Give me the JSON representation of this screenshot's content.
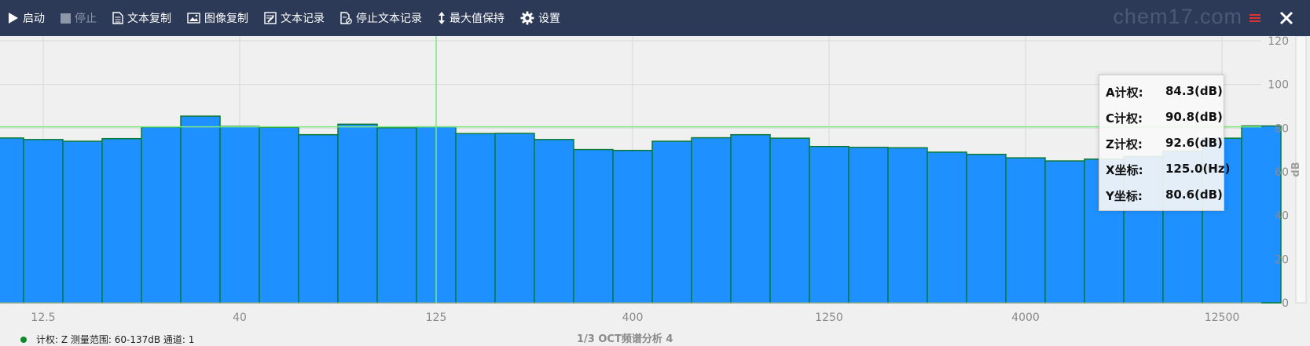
{
  "toolbar": {
    "start_label": "启动",
    "stop_label": "停止",
    "copy_text_label": "文本复制",
    "copy_image_label": "图像复制",
    "text_record_label": "文本记录",
    "stop_text_record_label": "停止文本记录",
    "max_hold_label": "最大值保持",
    "settings_label": "设置"
  },
  "watermark": "chem17.com",
  "readout": {
    "rows": [
      {
        "label": "A计权:",
        "value": "84.3(dB)"
      },
      {
        "label": "C计权:",
        "value": "90.8(dB)"
      },
      {
        "label": "Z计权:",
        "value": "92.6(dB)"
      },
      {
        "label": "X坐标:",
        "value": "125.0(Hz)"
      },
      {
        "label": "Y坐标:",
        "value": "80.6(dB)"
      }
    ]
  },
  "status": {
    "text": "计权: Z  测量范围: 60-137dB  通道: 1"
  },
  "chart_data": {
    "type": "bar",
    "title": "1/3 OCT频谱分析 4",
    "ylabel": "dB",
    "xlabel": "",
    "ylim": [
      0,
      120
    ],
    "yticks": [
      0,
      20,
      40,
      60,
      80,
      100,
      120
    ],
    "xtick_labels": [
      {
        "label": "12.5",
        "band": 1
      },
      {
        "label": "40",
        "band": 6
      },
      {
        "label": "125",
        "band": 11
      },
      {
        "label": "400",
        "band": 16
      },
      {
        "label": "1250",
        "band": 21
      },
      {
        "label": "4000",
        "band": 26
      },
      {
        "label": "12500",
        "band": 31
      }
    ],
    "values": [
      75.5,
      74.8,
      74.0,
      75.2,
      80.5,
      85.5,
      80.8,
      80.4,
      77.0,
      81.8,
      80.2,
      80.6,
      77.5,
      77.6,
      74.8,
      70.2,
      69.8,
      74.0,
      75.6,
      77.0,
      75.4,
      71.6,
      71.2,
      71.0,
      69.0,
      68.0,
      66.4,
      65.0,
      65.8,
      67.0,
      69.5,
      75.4,
      81.0
    ],
    "cursor": {
      "x_band": 11,
      "y": 80.6
    },
    "bar_color": "#1e90ff",
    "bar_edge_color": "#0a7a32",
    "cursor_color": "#7de87d",
    "grid": true
  }
}
